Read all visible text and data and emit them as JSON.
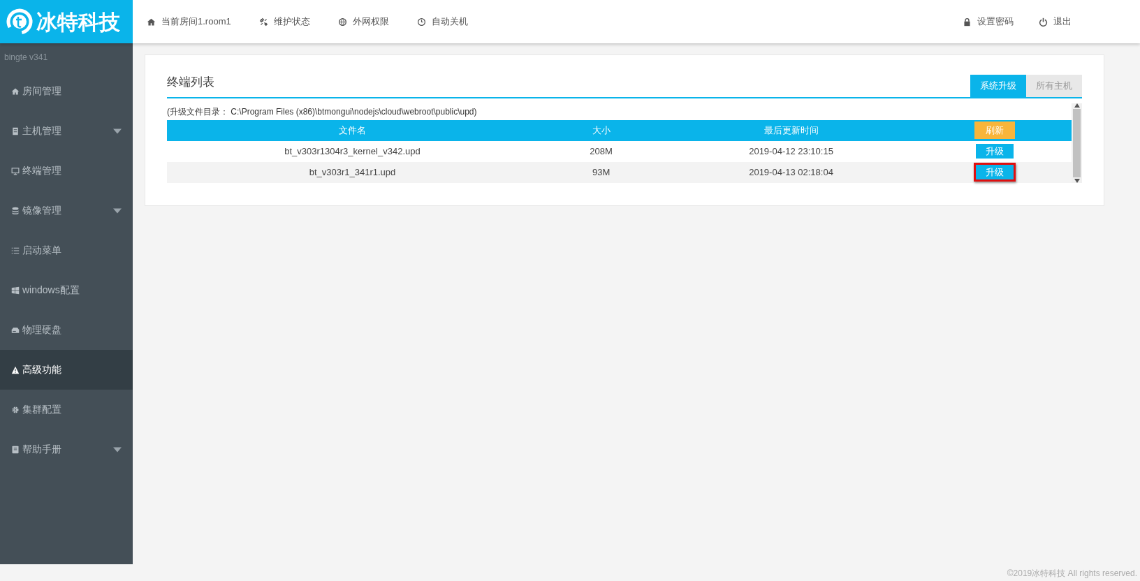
{
  "logo": {
    "text": "冰特科技"
  },
  "top_nav": [
    {
      "label": "当前房间1.room1"
    },
    {
      "label": "维护状态"
    },
    {
      "label": "外网权限"
    },
    {
      "label": "自动关机"
    }
  ],
  "top_right": [
    {
      "label": "设置密码"
    },
    {
      "label": "退出"
    }
  ],
  "sidebar": {
    "version": "bingte  v341",
    "items": [
      {
        "label": "房间管理",
        "expandable": false,
        "selected": false
      },
      {
        "label": "主机管理",
        "expandable": true,
        "selected": false
      },
      {
        "label": "终端管理",
        "expandable": false,
        "selected": false
      },
      {
        "label": "镜像管理",
        "expandable": true,
        "selected": false
      },
      {
        "label": "启动菜单",
        "expandable": false,
        "selected": false
      },
      {
        "label": "windows配置",
        "expandable": false,
        "selected": false
      },
      {
        "label": "物理硬盘",
        "expandable": false,
        "selected": false
      },
      {
        "label": "高级功能",
        "expandable": false,
        "selected": true
      },
      {
        "label": "集群配置",
        "expandable": false,
        "selected": false
      },
      {
        "label": "帮助手册",
        "expandable": true,
        "selected": false
      }
    ]
  },
  "panel": {
    "title": "终端列表",
    "tabs": [
      {
        "label": "系统升级",
        "selected": true
      },
      {
        "label": "所有主机",
        "selected": false
      }
    ],
    "directory_note": "(升级文件目录：  C:\\Program Files (x86)\\btmongui\\nodejs\\cloud\\webroot\\public\\upd)",
    "columns": [
      "文件名",
      "大小",
      "最后更新时间"
    ],
    "refresh_button": "刷新",
    "rows": [
      {
        "file": "bt_v303r1304r3_kernel_v342.upd",
        "size": "208M",
        "time": "2019-04-12 23:10:15",
        "action": {
          "label": "升级",
          "highlighted": false
        }
      },
      {
        "file": "bt_v303r1_341r1.upd",
        "size": "93M",
        "time": "2019-04-13 02:18:04",
        "action": {
          "label": "升级",
          "highlighted": true
        }
      }
    ]
  },
  "footer": "©2019冰特科技 All rights reserved."
}
